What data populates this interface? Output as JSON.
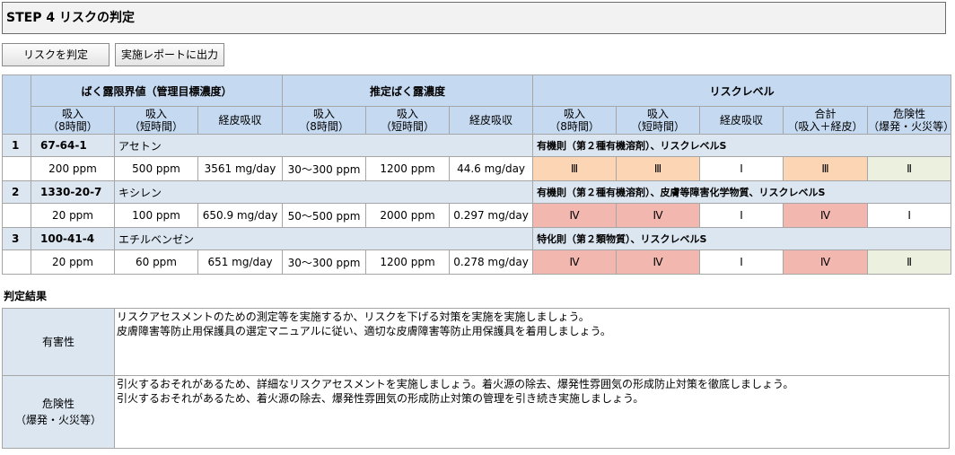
{
  "step_title": "STEP 4 リスクの判定",
  "buttons": {
    "judge": "リスクを判定",
    "report": "実施レポートに出力"
  },
  "headers": {
    "groups": {
      "limit": "ばく露限界値（管理目標濃度）",
      "estimated": "推定ばく露濃度",
      "risk": "リスクレベル"
    },
    "limit": [
      {
        "l1": "吸入",
        "l2": "（8時間）"
      },
      {
        "l1": "吸入",
        "l2": "（短時間）"
      },
      {
        "l1": "経皮吸収",
        "l2": ""
      }
    ],
    "estimated": [
      {
        "l1": "吸入",
        "l2": "（8時間）"
      },
      {
        "l1": "吸入",
        "l2": "（短時間）"
      },
      {
        "l1": "経皮吸収",
        "l2": ""
      }
    ],
    "risk": [
      {
        "l1": "吸入",
        "l2": "（8時間）"
      },
      {
        "l1": "吸入",
        "l2": "（短時間）"
      },
      {
        "l1": "経皮吸収",
        "l2": ""
      },
      {
        "l1": "合計",
        "l2": "（吸入＋経皮）"
      },
      {
        "l1": "危険性",
        "l2": "（爆発・火災等）"
      }
    ]
  },
  "chemicals": [
    {
      "no": "1",
      "cas": "67-64-1",
      "name": "アセトン",
      "law": "有機則（第２種有機溶剤）、リスクレベルS",
      "limit": [
        "200 ppm",
        "500 ppm",
        "3561 mg/day"
      ],
      "estimated": [
        "30～300 ppm",
        "1200 ppm",
        "44.6 mg/day"
      ],
      "risk": [
        "Ⅲ",
        "Ⅲ",
        "Ⅰ",
        "Ⅲ",
        "Ⅱ"
      ],
      "risk_colors": [
        "orange",
        "orange",
        "white",
        "orange",
        "green"
      ]
    },
    {
      "no": "2",
      "cas": "1330-20-7",
      "name": "キシレン",
      "law": "有機則（第２種有機溶剤）、皮膚等障害化学物質、リスクレベルS",
      "limit": [
        "20 ppm",
        "100 ppm",
        "650.9 mg/day"
      ],
      "estimated": [
        "50～500 ppm",
        "2000 ppm",
        "0.297 mg/day"
      ],
      "risk": [
        "Ⅳ",
        "Ⅳ",
        "Ⅰ",
        "Ⅳ",
        "Ⅰ"
      ],
      "risk_colors": [
        "red",
        "red",
        "white",
        "red",
        "white"
      ]
    },
    {
      "no": "3",
      "cas": "100-41-4",
      "name": "エチルベンゼン",
      "law": "特化則（第２類物質）、リスクレベルS",
      "limit": [
        "20 ppm",
        "60 ppm",
        "651 mg/day"
      ],
      "estimated": [
        "30～300 ppm",
        "1200 ppm",
        "0.278 mg/day"
      ],
      "risk": [
        "Ⅳ",
        "Ⅳ",
        "Ⅰ",
        "Ⅳ",
        "Ⅱ"
      ],
      "risk_colors": [
        "red",
        "red",
        "white",
        "red",
        "green"
      ]
    }
  ],
  "result": {
    "title": "判定結果",
    "harm": {
      "label": "有害性",
      "lines": [
        "リスクアセスメントのための測定等を実施するか、リスクを下げる対策を実施を実施しましょう。",
        "皮膚障害等防止用保護具の選定マニュアルに従い、適切な皮膚障害等防止用保護具を着用しましょう。"
      ]
    },
    "danger": {
      "label": "危険性",
      "label2": "（爆発・火災等）",
      "lines": [
        "引火するおそれがあるため、詳細なリスクアセスメントを実施しましょう。着火源の除去、爆発性雰囲気の形成防止対策を徹底しましょう。",
        "引火するおそれがあるため、着火源の除去、爆発性雰囲気の形成防止対策の管理を引き続き実施しましょう。"
      ]
    }
  },
  "colors": {
    "orange": "#fcd5b4",
    "red": "#f2b8b0",
    "green": "#ebf1de",
    "white": "#ffffff",
    "header": "#c5d9f1",
    "name_row": "#dce6f1"
  }
}
